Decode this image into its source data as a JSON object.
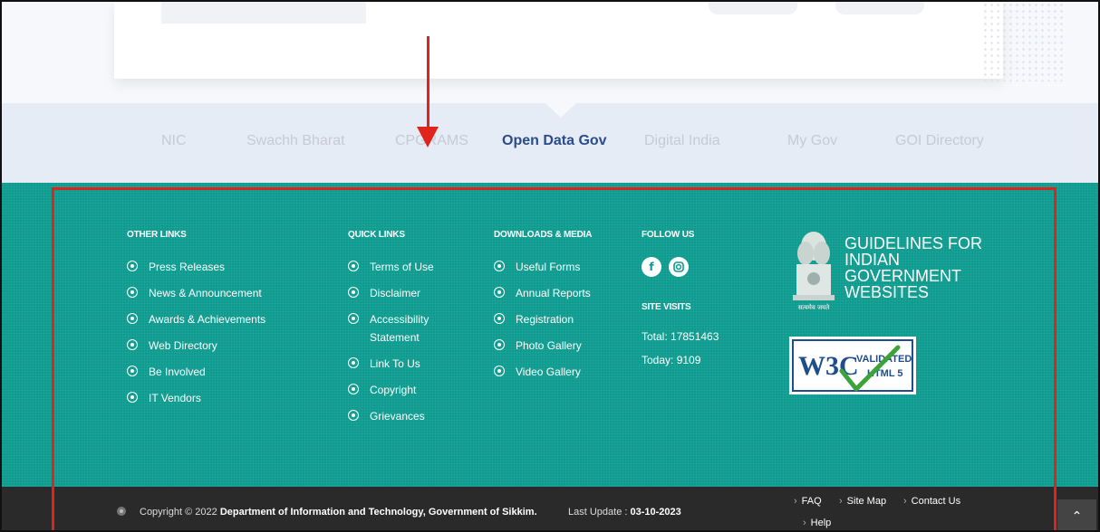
{
  "link_strip": {
    "items": [
      "NIC",
      "Swachh Bharat",
      "CPGRAMS",
      "Open Data Gov",
      "Digital India",
      "My Gov",
      "GOI Directory"
    ],
    "active": "Open Data Gov"
  },
  "footer": {
    "other_links": {
      "heading": "OTHER LINKS",
      "items": [
        "Press Releases",
        "News & Announcement",
        "Awards & Achievements",
        "Web Directory",
        "Be Involved",
        "IT Vendors"
      ]
    },
    "quick_links": {
      "heading": "QUICK LINKS",
      "items": [
        "Terms of Use",
        "Disclaimer",
        "Accessibility Statement",
        "Link To Us",
        "Copyright",
        "Grievances"
      ]
    },
    "downloads": {
      "heading": "DOWNLOADS & MEDIA",
      "items": [
        "Useful Forms",
        "Annual Reports",
        "Registration",
        "Photo Gallery",
        "Video Gallery"
      ]
    },
    "follow": {
      "heading": "FOLLOW US",
      "icons": [
        "facebook-icon",
        "instagram-icon"
      ],
      "site_visits_heading": "SITE VISITS",
      "total": "Total: 17851463",
      "today": "Today: 9109"
    },
    "guidelines": {
      "line1": "GUIDELINES FOR",
      "line2": "INDIAN",
      "line3": "GOVERNMENT",
      "line4": "WEBSITES",
      "emblem_caption": "सत्यमेव जयते"
    },
    "w3c": {
      "logo": "W3C",
      "validated": "VALIDATED",
      "version": "HTML 5"
    }
  },
  "bottom_bar": {
    "copyright_prefix": "Copyright © 2022 ",
    "copyright_org": "Department of Information and Technology, Government of Sikkim.",
    "last_update_label": "Last Update : ",
    "last_update_date": "03-10-2023",
    "links": [
      "FAQ",
      "Site Map",
      "Contact Us",
      "Help"
    ]
  },
  "colors": {
    "footer_bg": "#0e9b8f",
    "annotation_red": "#e0241c",
    "active_link": "#2b4c8c"
  }
}
